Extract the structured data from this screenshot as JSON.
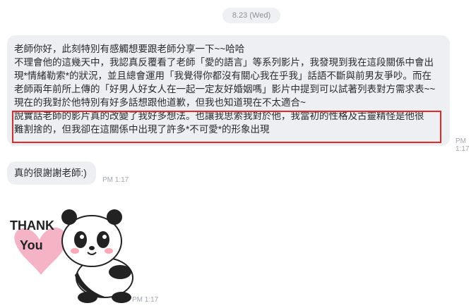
{
  "chat": {
    "date": "8.23 (Wed)",
    "message1": {
      "lines": [
        "老師你好，此刻特別有感觸想要跟老師分享一下~~哈哈",
        "不理會他的這幾天中，我認真反覆看了老師「愛的語言」等系列影片，我發現到我在這段關係中會出",
        "現*情緒勒索*的狀況，並且總會運用「我覺得你都沒有關心我在乎我」話語不斷與前男友爭吵。而在",
        "老師兩年前所上傳的「好男人好女人在一起一定友好婚姻嗎」影片中提到可以試著列表對方需求表~~",
        "現在的我對於他特別有好多話想跟他道歉，但我也知道現在不太適合~",
        "說實話老師的影片真的改變了我好多想法。也讓我思索我對於他，我當初的性格及古靈精怪是他很",
        "難割捨的，但我卻在這關係中出現了許多*不可愛*的形象出現"
      ],
      "time": "PM 1:17"
    },
    "message2": {
      "text": "真的很謝謝老師:)",
      "time": "PM 1:17"
    },
    "sticker": {
      "text_line1": "THANK",
      "text_line2": "You",
      "time": "PM 1:17"
    },
    "colors": {
      "bubble": "#edeff3",
      "highlight": "#e02a2a",
      "heart": "#f4b4c6"
    }
  }
}
